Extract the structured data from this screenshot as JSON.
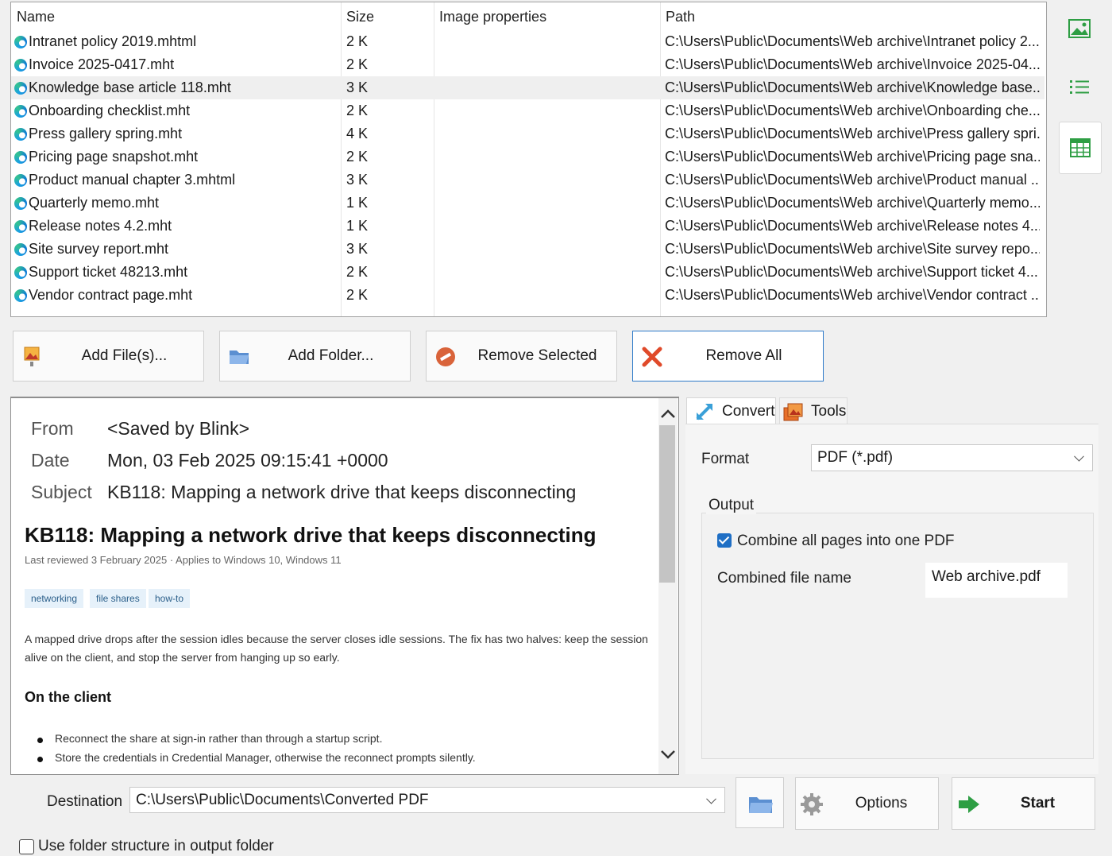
{
  "file_list": {
    "columns": [
      "Name",
      "Size",
      "Image properties",
      "Path"
    ],
    "rows": [
      {
        "name": "Intranet policy 2019.mhtml",
        "size": "2 K",
        "image_properties": "",
        "path": "C:\\Users\\Public\\Documents\\Web archive\\Intranet policy 2..."
      },
      {
        "name": "Invoice 2025-0417.mht",
        "size": "2 K",
        "image_properties": "",
        "path": "C:\\Users\\Public\\Documents\\Web archive\\Invoice 2025-04..."
      },
      {
        "name": "Knowledge base article 118.mht",
        "size": "3 K",
        "image_properties": "",
        "path": "C:\\Users\\Public\\Documents\\Web archive\\Knowledge base..."
      },
      {
        "name": "Onboarding checklist.mht",
        "size": "2 K",
        "image_properties": "",
        "path": "C:\\Users\\Public\\Documents\\Web archive\\Onboarding che..."
      },
      {
        "name": "Press gallery spring.mht",
        "size": "4 K",
        "image_properties": "",
        "path": "C:\\Users\\Public\\Documents\\Web archive\\Press gallery spri..."
      },
      {
        "name": "Pricing page snapshot.mht",
        "size": "2 K",
        "image_properties": "",
        "path": "C:\\Users\\Public\\Documents\\Web archive\\Pricing page sna..."
      },
      {
        "name": "Product manual chapter 3.mhtml",
        "size": "3 K",
        "image_properties": "",
        "path": "C:\\Users\\Public\\Documents\\Web archive\\Product manual ..."
      },
      {
        "name": "Quarterly memo.mht",
        "size": "1 K",
        "image_properties": "",
        "path": "C:\\Users\\Public\\Documents\\Web archive\\Quarterly memo..."
      },
      {
        "name": "Release notes 4.2.mht",
        "size": "1 K",
        "image_properties": "",
        "path": "C:\\Users\\Public\\Documents\\Web archive\\Release notes 4...."
      },
      {
        "name": "Site survey report.mht",
        "size": "3 K",
        "image_properties": "",
        "path": "C:\\Users\\Public\\Documents\\Web archive\\Site survey repo..."
      },
      {
        "name": "Support ticket 48213.mht",
        "size": "2 K",
        "image_properties": "",
        "path": "C:\\Users\\Public\\Documents\\Web archive\\Support ticket 4..."
      },
      {
        "name": "Vendor contract page.mht",
        "size": "2 K",
        "image_properties": "",
        "path": "C:\\Users\\Public\\Documents\\Web archive\\Vendor contract ..."
      }
    ],
    "selected_index": 2
  },
  "view_buttons": {
    "icons": [
      "thumbnail-view-icon",
      "list-view-icon",
      "details-view-icon"
    ],
    "active": "details-view-icon"
  },
  "actions": {
    "add_files": "Add File(s)...",
    "add_folder": "Add Folder...",
    "remove_selected": "Remove Selected",
    "remove_all": "Remove All"
  },
  "preview": {
    "from_label": "From",
    "from_value": "<Saved by Blink>",
    "date_label": "Date",
    "date_value": "Mon, 03 Feb 2025 09:15:41 +0000",
    "subject_label": "Subject",
    "subject_value": "KB118: Mapping a network drive that keeps disconnecting",
    "heading": "KB118: Mapping a network drive that keeps disconnecting",
    "meta_line": "Last reviewed 3 February 2025 · Applies to Windows 10, Windows 11",
    "tags": [
      "networking",
      "file shares",
      "how-to"
    ],
    "paragraph": "A mapped drive drops after the session idles because the server closes idle sessions. The fix has two halves: keep the session alive on the client, and stop the server from hanging up so early.",
    "section_heading": "On the client",
    "bullets": [
      "Reconnect the share at sign-in rather than through a startup script.",
      "Store the credentials in Credential Manager, otherwise the reconnect prompts silently."
    ]
  },
  "tabs": [
    {
      "label": "Convert",
      "icon": "convert-icon",
      "active": true
    },
    {
      "label": "Tools",
      "icon": "tools-icon",
      "active": false
    }
  ],
  "convert": {
    "format_label": "Format",
    "format_value": "PDF (*.pdf)",
    "output_group_label": "Output",
    "combine_label": "Combine all pages into one PDF",
    "combine_checked": true,
    "combined_name_label": "Combined file name",
    "combined_name_value": "Web archive.pdf"
  },
  "footer": {
    "destination_label": "Destination",
    "destination_value": "C:\\Users\\Public\\Documents\\Converted PDF",
    "options_label": "Options",
    "start_label": "Start",
    "folder_structure_label": "Use folder structure in output folder",
    "folder_structure_checked": false
  },
  "colors": {
    "accent": "#1f6fc5",
    "selected_row": "#efefef",
    "green_icon": "#2e9e44",
    "focus_border": "#2e7ac9"
  }
}
